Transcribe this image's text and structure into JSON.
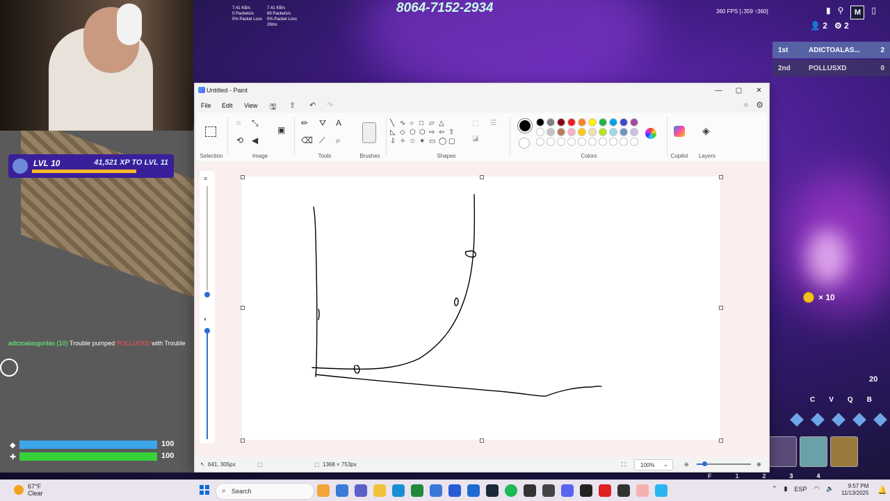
{
  "game": {
    "code": "8064-7152-2934",
    "fps": "360 FPS [↓359 ↑360]",
    "net_left": [
      "7.41 KB/s",
      "0 Packets/s",
      "0% Packet Loss"
    ],
    "net_right": [
      "7.41 KB/s",
      "69 Packets/s",
      "0% Packet Loss",
      "28ms"
    ],
    "players_count": "2",
    "spectators_count": "2",
    "map_key": "M",
    "leaderboard": [
      {
        "place": "1st",
        "name": "ADICTOALAS...",
        "score": "2"
      },
      {
        "place": "2nd",
        "name": "POLLUSXD",
        "score": "0"
      }
    ],
    "level": "LVL 10",
    "xp": "41,521 XP TO LVL 11",
    "killfeed": {
      "player": "adictoalasgorilas (10)",
      "text1": " Trouble pumped ",
      "victim": "POLLUSXD",
      "text2": " with Trouble"
    },
    "coins": "× 10",
    "materials": "20",
    "keys": [
      "C",
      "V",
      "Q",
      "B"
    ],
    "slot_numbers": [
      "F",
      "1",
      "2",
      "3",
      "4"
    ],
    "shield": "100",
    "health": "100",
    "shield_percent": 100,
    "health_percent": 100
  },
  "paint": {
    "window_title": "Untitled - Paint",
    "menu": [
      "File",
      "Edit",
      "View"
    ],
    "groups": {
      "selection": "Selection",
      "image": "Image",
      "tools": "Tools",
      "brushes": "Brushes",
      "shapes": "Shapes",
      "colors": "Colors",
      "copilot": "Copilot",
      "layers": "Layers"
    },
    "palette_row1": [
      "#000000",
      "#7f7f7f",
      "#880015",
      "#ed1c24",
      "#ff7f27",
      "#fff200",
      "#22b14c",
      "#00a2e8",
      "#3f48cc",
      "#a349a4"
    ],
    "palette_row2": [
      "#ffffff",
      "#c3c3c3",
      "#b97a57",
      "#ffaec9",
      "#ffc90e",
      "#efe4b0",
      "#b5e61d",
      "#99d9ea",
      "#7092be",
      "#c8bfe7"
    ],
    "palette_row3_count": 10,
    "status": {
      "cursor": "641, 305px",
      "canvas_size": "1368 × 753px",
      "zoom": "100%"
    }
  },
  "taskbar": {
    "temp": "67°F",
    "condition": "Clear",
    "search": "Search",
    "lang": "ESP",
    "time": "9:57 PM",
    "date": "11/13/2025"
  }
}
